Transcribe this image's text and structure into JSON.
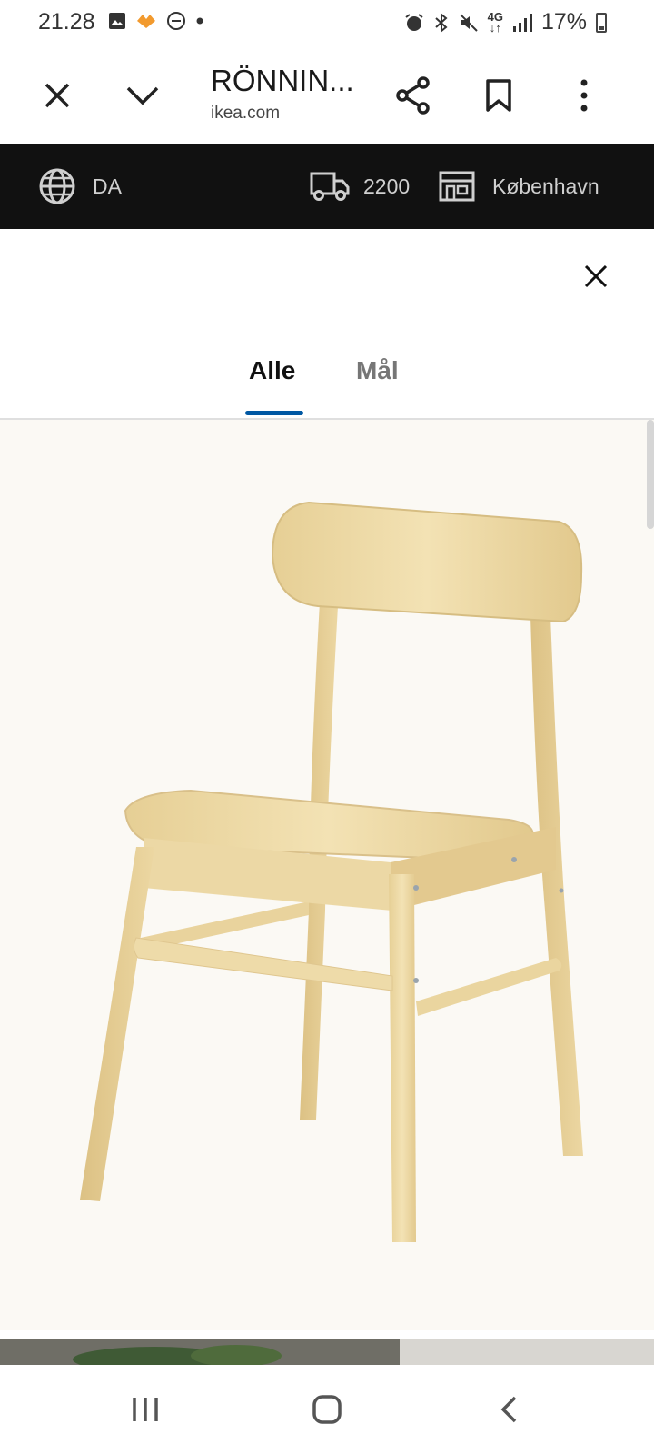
{
  "status_bar": {
    "time": "21.28",
    "battery": "17%",
    "network": "4G",
    "icons": [
      "gallery-icon",
      "app-icon",
      "dnd-icon",
      "dot-icon",
      "alarm-icon",
      "bluetooth-icon",
      "mute-icon",
      "network-4g-icon",
      "signal-icon",
      "battery-icon"
    ]
  },
  "browser": {
    "title": "RÖNNIN...",
    "url": "ikea.com",
    "icons": [
      "close-icon",
      "chevron-down-icon",
      "share-icon",
      "bookmark-icon",
      "more-icon"
    ]
  },
  "ikea_bar": {
    "language": "DA",
    "delivery_postcode": "2200",
    "store": "København"
  },
  "sheet": {
    "tabs": [
      {
        "label": "Alle",
        "active": true
      },
      {
        "label": "Mål",
        "active": false
      }
    ]
  },
  "colors": {
    "ikea_bar_bg": "#111111",
    "tab_indicator": "#0058a3",
    "image_bg": "#fbf9f4",
    "chair_wood": "#ecd9a6"
  }
}
